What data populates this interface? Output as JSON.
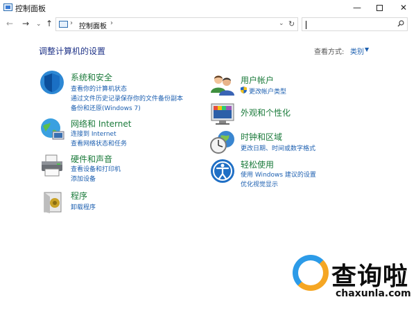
{
  "window": {
    "title": "控制面板",
    "buttons": {
      "minimize": "—",
      "close": "✕"
    }
  },
  "nav": {
    "back": "←",
    "forward": "→",
    "recent": "⌄",
    "up": "↑",
    "breadcrumb_sep": "›",
    "breadcrumb": "控制面板",
    "address_dropdown": "⌄",
    "refresh": "↻",
    "search_placeholder": ""
  },
  "heading": "调整计算机的设置",
  "view_by": {
    "label": "查看方式:",
    "value": "类别",
    "arrow": "▼"
  },
  "categories": {
    "system": {
      "title": "系统和安全",
      "links": [
        "查看你的计算机状态",
        "通过文件历史记录保存你的文件备份副本",
        "备份和还原(Windows 7)"
      ]
    },
    "network": {
      "title": "网络和 Internet",
      "links": [
        "连接到 Internet",
        "查看网络状态和任务"
      ]
    },
    "hardware": {
      "title": "硬件和声音",
      "links": [
        "查看设备和打印机",
        "添加设备"
      ]
    },
    "programs": {
      "title": "程序",
      "links": [
        "卸载程序"
      ]
    },
    "users": {
      "title": "用户帐户",
      "links": [
        "更改帐户类型"
      ]
    },
    "appearance": {
      "title": "外观和个性化",
      "links": []
    },
    "clock": {
      "title": "时钟和区域",
      "links": [
        "更改日期、时间或数字格式"
      ]
    },
    "ease": {
      "title": "轻松使用",
      "links": [
        "使用 Windows 建议的设置",
        "优化视觉显示"
      ]
    }
  },
  "watermark": {
    "text": "查询啦",
    "url": "chaxunla.com"
  },
  "colors": {
    "category_title": "#1a7a3a",
    "link": "#1c5fb0",
    "heading": "#1e3287",
    "watermark_blue": "#2c9be8",
    "watermark_orange": "#f5a623"
  }
}
